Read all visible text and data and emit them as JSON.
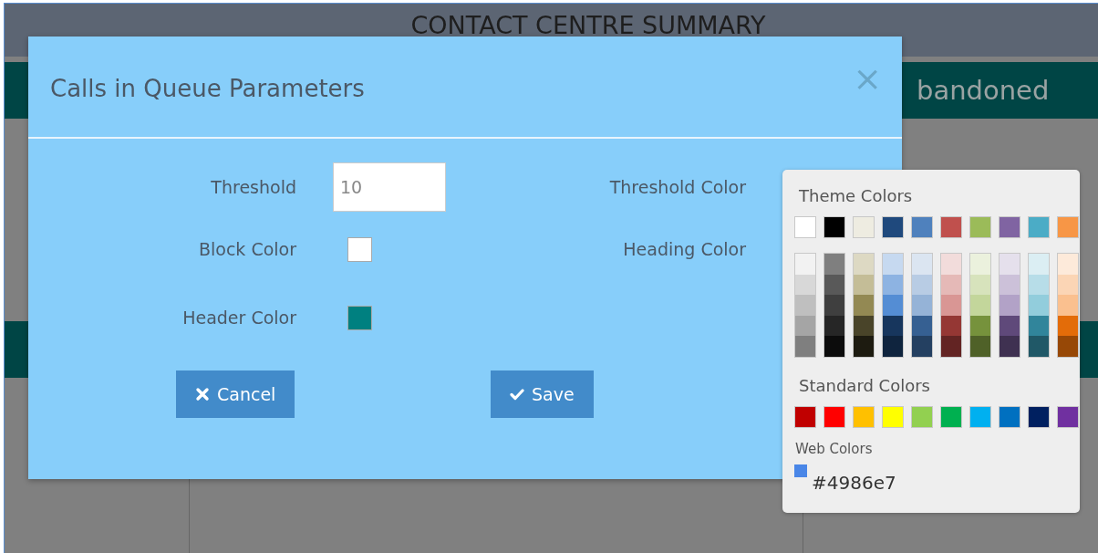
{
  "dashboard": {
    "title": "CONTACT CENTRE SUMMARY",
    "heading_1": "bandoned"
  },
  "dialog": {
    "title": "Calls in Queue Parameters",
    "close": "×",
    "left_fields": [
      {
        "kind": "input",
        "label": "Threshold",
        "value": "10"
      },
      {
        "kind": "swatch",
        "label": "Block Color",
        "color": "#ffffff"
      },
      {
        "kind": "swatch",
        "label": "Header Color",
        "color": "#008080"
      }
    ],
    "right_fields": [
      {
        "kind": "label",
        "label": "Threshold Color"
      },
      {
        "kind": "label",
        "label": "Heading Color"
      }
    ],
    "buttons": [
      {
        "kind": "cancel",
        "label": "Cancel"
      },
      {
        "kind": "save",
        "label": "Save"
      }
    ]
  },
  "color_picker": {
    "theme_title": "Theme Colors",
    "theme": [
      {
        "color": "#ffffff",
        "shades": [
          {
            "color": "#f2f2f2"
          },
          {
            "color": "#d8d8d8"
          },
          {
            "color": "#bfbfbf"
          },
          {
            "color": "#a5a5a5"
          },
          {
            "color": "#7f7f7f"
          }
        ]
      },
      {
        "color": "#000000",
        "shades": [
          {
            "color": "#7f7f7f"
          },
          {
            "color": "#595959"
          },
          {
            "color": "#3f3f3f"
          },
          {
            "color": "#262626"
          },
          {
            "color": "#0c0c0c"
          }
        ]
      },
      {
        "color": "#eeece1",
        "shades": [
          {
            "color": "#ddd9c3"
          },
          {
            "color": "#c4bd97"
          },
          {
            "color": "#938953"
          },
          {
            "color": "#494429"
          },
          {
            "color": "#1d1b10"
          }
        ]
      },
      {
        "color": "#1f497d",
        "shades": [
          {
            "color": "#c6d9f0"
          },
          {
            "color": "#8db3e2"
          },
          {
            "color": "#548dd4"
          },
          {
            "color": "#17365d"
          },
          {
            "color": "#0f243e"
          }
        ]
      },
      {
        "color": "#4f81bd",
        "shades": [
          {
            "color": "#dbe5f1"
          },
          {
            "color": "#b8cce4"
          },
          {
            "color": "#95b3d7"
          },
          {
            "color": "#366092"
          },
          {
            "color": "#244061"
          }
        ]
      },
      {
        "color": "#c0504d",
        "shades": [
          {
            "color": "#f2dcdb"
          },
          {
            "color": "#e5b9b7"
          },
          {
            "color": "#d99694"
          },
          {
            "color": "#953734"
          },
          {
            "color": "#632423"
          }
        ]
      },
      {
        "color": "#9bbb59",
        "shades": [
          {
            "color": "#ebf1dd"
          },
          {
            "color": "#d7e3bc"
          },
          {
            "color": "#c3d69b"
          },
          {
            "color": "#76923c"
          },
          {
            "color": "#4f6128"
          }
        ]
      },
      {
        "color": "#8064a2",
        "shades": [
          {
            "color": "#e5e0ec"
          },
          {
            "color": "#ccc1d9"
          },
          {
            "color": "#b2a2c7"
          },
          {
            "color": "#5f497a"
          },
          {
            "color": "#3f3151"
          }
        ]
      },
      {
        "color": "#4bacc6",
        "shades": [
          {
            "color": "#dbeef3"
          },
          {
            "color": "#b7dde8"
          },
          {
            "color": "#92cddc"
          },
          {
            "color": "#31859b"
          },
          {
            "color": "#205867"
          }
        ]
      },
      {
        "color": "#f79646",
        "shades": [
          {
            "color": "#fdeada"
          },
          {
            "color": "#fbd5b5"
          },
          {
            "color": "#fac08f"
          },
          {
            "color": "#e36c09"
          },
          {
            "color": "#974806"
          }
        ]
      }
    ],
    "standard_title": "Standard Colors",
    "standard": [
      {
        "color": "#c00000"
      },
      {
        "color": "#ff0000"
      },
      {
        "color": "#ffc000"
      },
      {
        "color": "#ffff00"
      },
      {
        "color": "#92d050"
      },
      {
        "color": "#00b050"
      },
      {
        "color": "#00b0f0"
      },
      {
        "color": "#0070c0"
      },
      {
        "color": "#002060"
      },
      {
        "color": "#7030a0"
      }
    ],
    "web_title": "Web Colors",
    "web_color": "#4986e7"
  }
}
